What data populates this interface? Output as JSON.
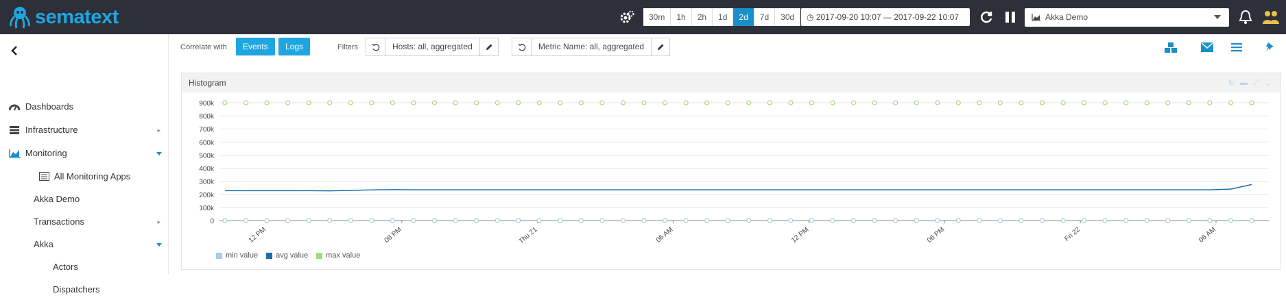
{
  "header": {
    "logo_text": "sematext",
    "time_ranges": [
      "30m",
      "1h",
      "2h",
      "1d",
      "2d",
      "7d",
      "30d"
    ],
    "active_range": "2d",
    "date_range": "2017-09-20 10:07 — 2017-09-22 10:07",
    "app_selector": "Akka Demo",
    "colors": {
      "bg": "#2d3038",
      "brand": "#1fa6e0",
      "active": "#1a8fc9"
    }
  },
  "sidebar": {
    "items": [
      {
        "label": "Dashboards",
        "icon": "dashboard-icon"
      },
      {
        "label": "Infrastructure",
        "icon": "server-icon"
      },
      {
        "label": "Monitoring",
        "icon": "area-chart-icon"
      },
      {
        "label": "All Monitoring Apps",
        "icon": "list-icon"
      },
      {
        "label": "Akka Demo"
      },
      {
        "label": "Transactions"
      },
      {
        "label": "Akka"
      },
      {
        "label": "Actors"
      },
      {
        "label": "Dispatchers"
      }
    ]
  },
  "toolbar": {
    "correlate_label": "Correlate with",
    "events_button": "Events",
    "logs_button": "Logs",
    "filters_label": "Filters",
    "host_filter": "Hosts: all, aggregated",
    "metric_filter": "Metric Name: all, aggregated"
  },
  "panel": {
    "title": "Histogram"
  },
  "chart_data": {
    "type": "line",
    "title": "Histogram",
    "ylim": [
      0,
      900000
    ],
    "y_ticks": [
      "0",
      "100k",
      "200k",
      "300k",
      "400k",
      "500k",
      "600k",
      "700k",
      "800k",
      "900k"
    ],
    "x_ticks": [
      "12 PM",
      "06 PM",
      "Thu 21",
      "06 AM",
      "12 PM",
      "06 PM",
      "Fri 22",
      "06 AM"
    ],
    "grid": true,
    "legend_placement": "bottom-left",
    "series": [
      {
        "name": "min value",
        "color": "#a9cbe5",
        "values": [
          0,
          0,
          0,
          0,
          0,
          0,
          0,
          0,
          0,
          0,
          0,
          0,
          0,
          0,
          0,
          0,
          0,
          0,
          0,
          0,
          0,
          0,
          0,
          0,
          0,
          0,
          0,
          0,
          0,
          0,
          0,
          0,
          0,
          0,
          0,
          0,
          0,
          0,
          0,
          0,
          0,
          0,
          0,
          0,
          0,
          0,
          0,
          0,
          0,
          0
        ]
      },
      {
        "name": "avg value",
        "color": "#1f6ea8",
        "values": [
          228000,
          228000,
          228000,
          228000,
          228000,
          227000,
          230000,
          234000,
          236000,
          235000,
          235000,
          235000,
          235000,
          235000,
          235000,
          235000,
          235000,
          235000,
          235000,
          235000,
          235000,
          235000,
          235000,
          235000,
          235000,
          235000,
          235000,
          235000,
          235000,
          235000,
          235000,
          235000,
          235000,
          235000,
          235000,
          235000,
          235000,
          235000,
          235000,
          235000,
          235000,
          235000,
          235000,
          235000,
          235000,
          235000,
          235000,
          235000,
          240000,
          275000
        ]
      },
      {
        "name": "max value",
        "color": "#a8d87d",
        "values": [
          900000,
          900000,
          900000,
          900000,
          900000,
          900000,
          900000,
          900000,
          900000,
          900000,
          900000,
          900000,
          900000,
          900000,
          900000,
          900000,
          900000,
          900000,
          900000,
          900000,
          900000,
          900000,
          900000,
          900000,
          900000,
          900000,
          900000,
          900000,
          900000,
          900000,
          900000,
          900000,
          900000,
          900000,
          900000,
          900000,
          900000,
          900000,
          900000,
          900000,
          900000,
          900000,
          900000,
          900000,
          900000,
          900000,
          900000,
          900000,
          900000,
          900000
        ]
      }
    ]
  }
}
